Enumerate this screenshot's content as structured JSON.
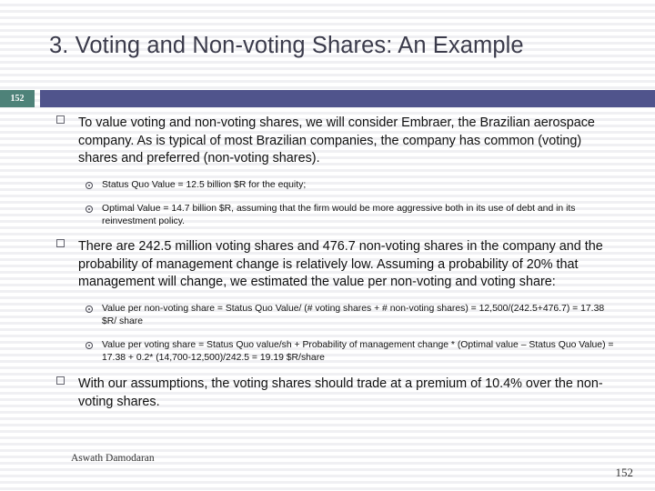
{
  "slide": {
    "title": "3. Voting and Non-voting Shares: An Example",
    "number_badge": "152",
    "accent_bar_color": "#50548c",
    "badge_color": "#4e8279",
    "title_color": "#3b3b4b"
  },
  "content": {
    "bullets": [
      {
        "level": 1,
        "text": "To value voting and non-voting shares, we will consider Embraer, the Brazilian aerospace company. As is typical of most Brazilian companies, the company has common (voting) shares and preferred (non-voting shares)."
      },
      {
        "level": 2,
        "text": "Status Quo Value = 12.5 billion $R for the equity;"
      },
      {
        "level": 2,
        "text": "Optimal Value = 14.7 billion $R, assuming that the firm would be more aggressive both in its use of debt and in its reinvestment policy."
      },
      {
        "level": 1,
        "text": "There are 242.5 million voting shares and 476.7 non-voting shares in the company and the probability of management change is relatively low. Assuming a probability of 20% that management will change, we estimated the value per non-voting and voting share:"
      },
      {
        "level": 2,
        "text": "Value per non-voting share = Status Quo Value/ (# voting shares + # non-voting shares) = 12,500/(242.5+476.7) = 17.38 $R/ share"
      },
      {
        "level": 2,
        "text": "Value per voting share = Status Quo value/sh + Probability of management change * (Optimal value – Status Quo Value) = 17.38 + 0.2* (14,700-12,500)/242.5 = 19.19 $R/share"
      },
      {
        "level": 1,
        "text": "With our assumptions, the voting shares should trade at a premium of 10.4% over the non-voting shares."
      }
    ]
  },
  "footer": {
    "author": "Aswath Damodaran",
    "page_number": "152"
  }
}
